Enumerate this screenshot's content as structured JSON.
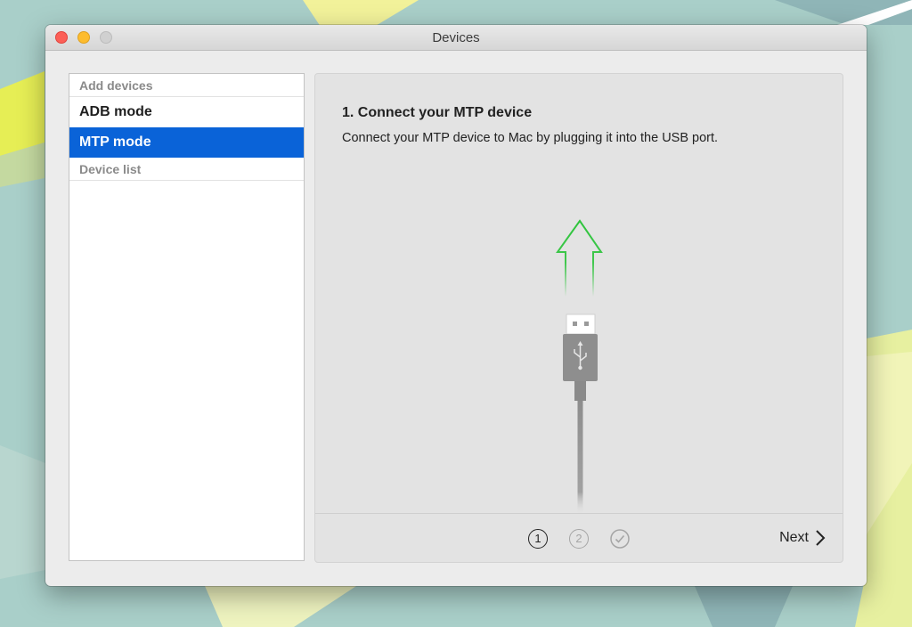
{
  "window": {
    "title": "Devices"
  },
  "sidebar": {
    "header_add": "Add devices",
    "items": [
      {
        "label": "ADB mode",
        "selected": false
      },
      {
        "label": "MTP mode",
        "selected": true
      }
    ],
    "header_list": "Device list"
  },
  "main": {
    "step_title": "1. Connect your MTP device",
    "step_description": "Connect your MTP device to Mac by plugging it into the USB port.",
    "illustration_icon": "usb-cable-icon"
  },
  "footer": {
    "steps": [
      {
        "label": "1",
        "state": "active"
      },
      {
        "label": "2",
        "state": "inactive"
      },
      {
        "label": "",
        "icon": "checkmark-icon",
        "state": "inactive"
      }
    ],
    "next_label": "Next"
  },
  "colors": {
    "selection": "#0a63d8",
    "close": "#fc5f57",
    "minimize": "#fdbc2e",
    "arrow": "#2ec43c"
  }
}
